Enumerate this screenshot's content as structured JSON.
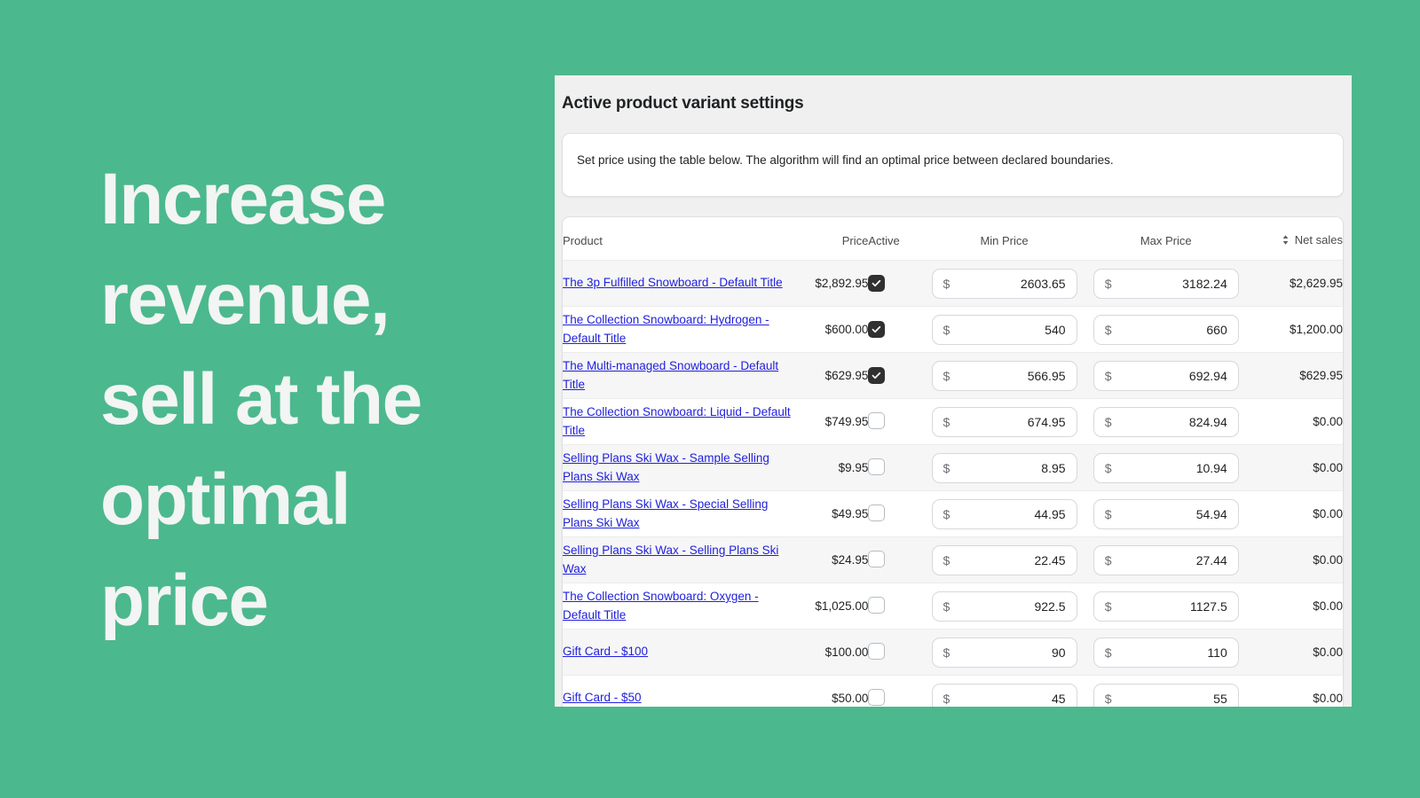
{
  "theme": {
    "background": "#4cb88e",
    "panel_background": "#f0f0f0",
    "link_color": "#2121dd",
    "checkbox_checked": "#303030"
  },
  "hero": {
    "headline": "Increase revenue, sell at the optimal price"
  },
  "panel": {
    "title": "Active product variant settings",
    "info": "Set price using the table below. The algorithm will find an optimal price between declared boundaries."
  },
  "table": {
    "columns": {
      "product": "Product",
      "price": "Price",
      "active": "Active",
      "min_price": "Min Price",
      "max_price": "Max Price",
      "net_sales": "Net sales"
    },
    "sort_icon": "sort-updown-icon",
    "currency_prefix": "$",
    "rows": [
      {
        "product": "The 3p Fulfilled Snowboard - Default Title",
        "price": "$2,892.95",
        "active": true,
        "min_price": "2603.65",
        "max_price": "3182.24",
        "net_sales": "$2,629.95"
      },
      {
        "product": "The Collection Snowboard: Hydrogen - Default Title",
        "price": "$600.00",
        "active": true,
        "min_price": "540",
        "max_price": "660",
        "net_sales": "$1,200.00"
      },
      {
        "product": "The Multi-managed Snowboard - Default Title",
        "price": "$629.95",
        "active": true,
        "min_price": "566.95",
        "max_price": "692.94",
        "net_sales": "$629.95"
      },
      {
        "product": "The Collection Snowboard: Liquid - Default Title",
        "price": "$749.95",
        "active": false,
        "min_price": "674.95",
        "max_price": "824.94",
        "net_sales": "$0.00"
      },
      {
        "product": "Selling Plans Ski Wax - Sample Selling Plans Ski Wax",
        "price": "$9.95",
        "active": false,
        "min_price": "8.95",
        "max_price": "10.94",
        "net_sales": "$0.00"
      },
      {
        "product": "Selling Plans Ski Wax - Special Selling Plans Ski Wax",
        "price": "$49.95",
        "active": false,
        "min_price": "44.95",
        "max_price": "54.94",
        "net_sales": "$0.00"
      },
      {
        "product": "Selling Plans Ski Wax - Selling Plans Ski Wax",
        "price": "$24.95",
        "active": false,
        "min_price": "22.45",
        "max_price": "27.44",
        "net_sales": "$0.00"
      },
      {
        "product": "The Collection Snowboard: Oxygen - Default Title",
        "price": "$1,025.00",
        "active": false,
        "min_price": "922.5",
        "max_price": "1127.5",
        "net_sales": "$0.00"
      },
      {
        "product": "Gift Card - $100",
        "price": "$100.00",
        "active": false,
        "min_price": "90",
        "max_price": "110",
        "net_sales": "$0.00"
      },
      {
        "product": "Gift Card - $50",
        "price": "$50.00",
        "active": false,
        "min_price": "45",
        "max_price": "55",
        "net_sales": "$0.00"
      }
    ]
  }
}
